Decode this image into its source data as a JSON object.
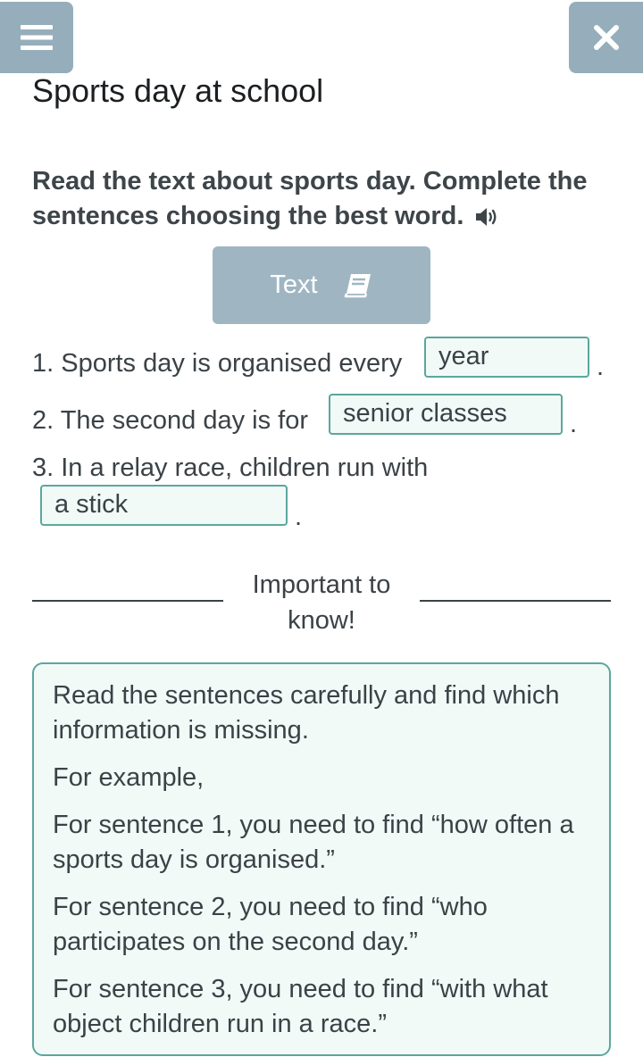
{
  "header": {
    "menu_icon": "hamburger-menu-icon",
    "close_icon": "close-icon",
    "title": "Sports day at school"
  },
  "instruction": {
    "text": "Read the text about sports day. Complete the sentences choosing the best word.",
    "audio_icon": "speaker-icon"
  },
  "text_button": {
    "label": "Text",
    "icon": "book-icon"
  },
  "sentences": [
    {
      "prefix": "1. Sports day is organised every",
      "answer": "year",
      "suffix": "."
    },
    {
      "prefix": "2. The second day is for",
      "answer": "senior classes",
      "suffix": "."
    },
    {
      "prefix": "3. In a relay race, children run with",
      "answer": "a stick",
      "suffix": "."
    }
  ],
  "important": {
    "heading": "Important to know!"
  },
  "info": {
    "paragraphs": [
      "Read the sentences carefully and find which information is missing.",
      "For example,",
      "For sentence 1, you need to find “how often a sports day is organised.”",
      "For sentence 2, you need to find “who participates on the second day.”",
      "For sentence 3, you need to find “with what object children run in a race.”"
    ]
  },
  "colors": {
    "header_button": "#96aebb",
    "text_button": "#9fb6c2",
    "answer_border": "#5ba79e",
    "answer_bg": "#f2faf7"
  }
}
